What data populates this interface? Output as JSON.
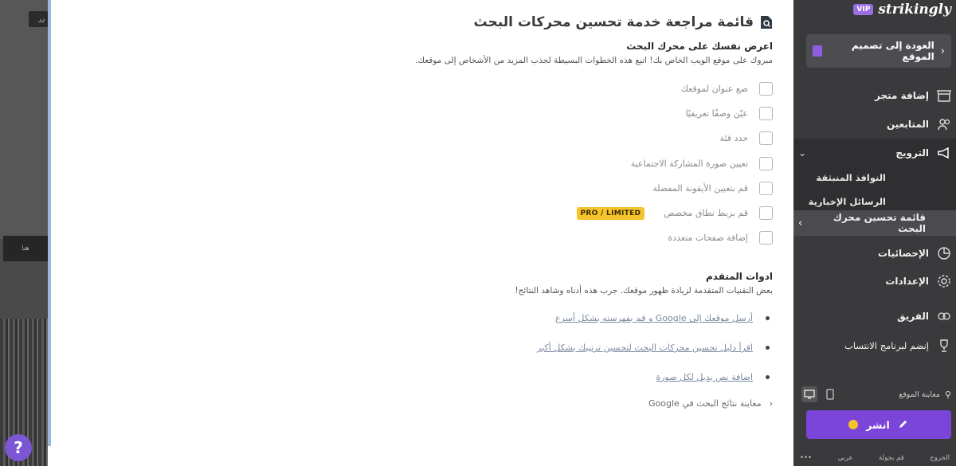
{
  "background": {
    "top_button": "زر",
    "mid_button": "هنا"
  },
  "help": {
    "label": "?"
  },
  "main": {
    "title": "قائمة مراجعة خدمة تحسين محركات البحث",
    "intro_heading": "اعرض نفسك على محرك البحث",
    "intro_text": "مبروك على موقع الويب الخاص بك! اتبع هذه الخطوات البسيطة لجذب المزيد من الأشخاص إلى موقعك.",
    "checklist": [
      {
        "label": "ضع عنوان لموقعك"
      },
      {
        "label": "عيّن وصفًا تعريفيًا"
      },
      {
        "label": "حدد فئة"
      },
      {
        "label": "تعيين صورة المشاركة الاجتماعية"
      },
      {
        "label": "قم بتعيين الأيقونة المفضلة"
      },
      {
        "label": "قم بربط نطاق مخصص",
        "badge": "PRO / LIMITED"
      },
      {
        "label": "إضافة صفحات متعددة"
      }
    ],
    "advanced_heading": "ادوات المتقدم",
    "advanced_text": "بعض التقنيات المتقدمة لزيادة ظهور موقعك. جرب هذه أدناه وشاهد النتائج!",
    "links": [
      {
        "label": "أرسل موقعك إلى Google و قم بفهرسته بشكل أسرع"
      },
      {
        "label": "اقرأ دليل تحسين محركات البحث لتحسين ترتيبك بشكل أكبر"
      },
      {
        "label": "اضافة نص بديل لكل صورة"
      }
    ],
    "preview_google": "معاينة نتائج البحث في Google"
  },
  "sidebar": {
    "brand": "strikingly",
    "vip": "VIP",
    "back_label": "العودة إلى تصميم الموقع",
    "items": [
      {
        "label": "إضافة متجر",
        "icon": "store-icon"
      },
      {
        "label": "المتابعين",
        "icon": "users-icon"
      },
      {
        "label": "الترويج",
        "icon": "megaphone-icon"
      },
      {
        "label": "النوافذ المنبثقة"
      },
      {
        "label": "الرسائل الإخبارية"
      },
      {
        "label": "قائمة تحسين محرك البحث"
      },
      {
        "label": "الإحصائيات",
        "icon": "chart-icon"
      },
      {
        "label": "الإعدادات",
        "icon": "gear-icon"
      },
      {
        "label": "الفريق",
        "icon": "team-icon"
      },
      {
        "label": "إنضم لبرنامج الانتساب",
        "icon": "trophy-icon"
      }
    ],
    "preview_label": "معاينة الموقع",
    "publish_label": "انشر",
    "footer": [
      "الخروج",
      "قم بجولة",
      "عربي",
      "•••"
    ]
  },
  "colors": {
    "accent": "#7a45d8",
    "badge": "#f5c42c",
    "sidebar_bg": "#3a3a3d"
  }
}
